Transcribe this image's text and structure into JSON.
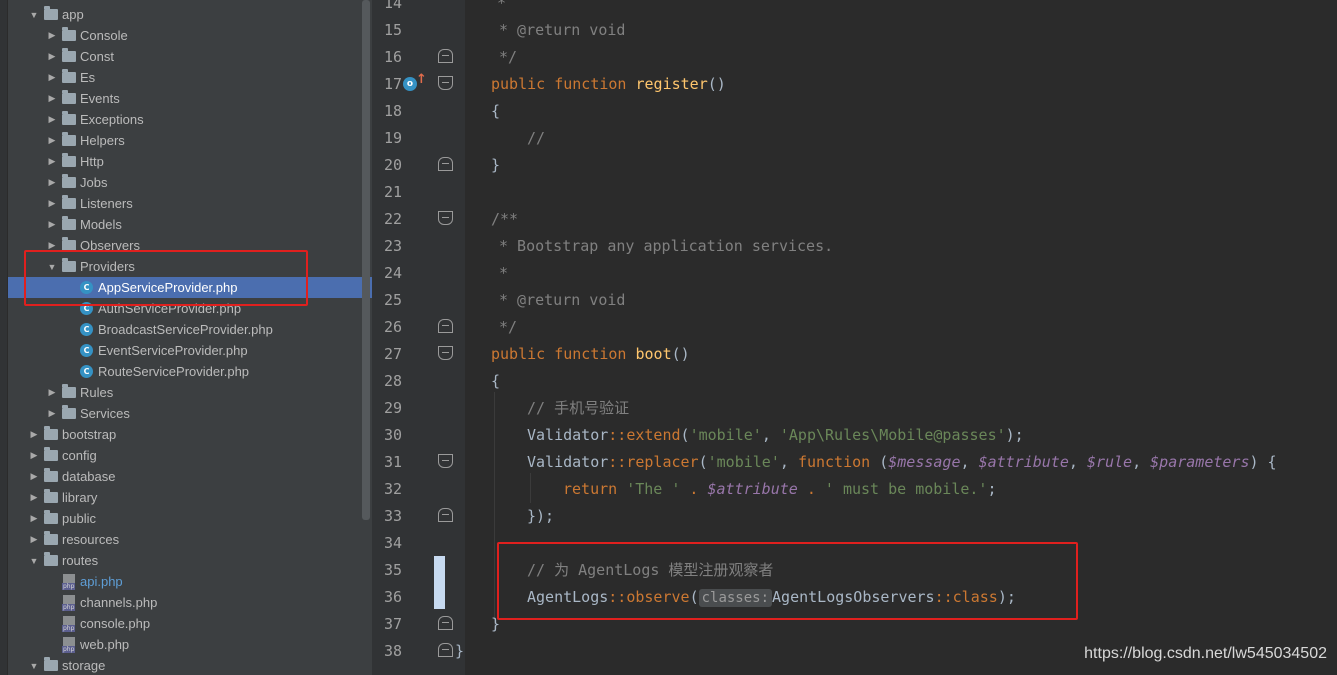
{
  "tree": {
    "rows": [
      {
        "label": "app",
        "indent": 1,
        "type": "folder",
        "state": "open"
      },
      {
        "label": "Console",
        "indent": 2,
        "type": "folder",
        "state": "closed"
      },
      {
        "label": "Const",
        "indent": 2,
        "type": "folder",
        "state": "closed"
      },
      {
        "label": "Es",
        "indent": 2,
        "type": "folder",
        "state": "closed"
      },
      {
        "label": "Events",
        "indent": 2,
        "type": "folder",
        "state": "closed"
      },
      {
        "label": "Exceptions",
        "indent": 2,
        "type": "folder",
        "state": "closed"
      },
      {
        "label": "Helpers",
        "indent": 2,
        "type": "folder",
        "state": "closed"
      },
      {
        "label": "Http",
        "indent": 2,
        "type": "folder",
        "state": "closed"
      },
      {
        "label": "Jobs",
        "indent": 2,
        "type": "folder",
        "state": "closed"
      },
      {
        "label": "Listeners",
        "indent": 2,
        "type": "folder",
        "state": "closed"
      },
      {
        "label": "Models",
        "indent": 2,
        "type": "folder",
        "state": "closed"
      },
      {
        "label": "Observers",
        "indent": 2,
        "type": "folder",
        "state": "closed"
      },
      {
        "label": "Providers",
        "indent": 2,
        "type": "folder",
        "state": "open"
      },
      {
        "label": "AppServiceProvider.php",
        "indent": 3,
        "type": "class",
        "selected": true
      },
      {
        "label": "AuthServiceProvider.php",
        "indent": 3,
        "type": "class"
      },
      {
        "label": "BroadcastServiceProvider.php",
        "indent": 3,
        "type": "class"
      },
      {
        "label": "EventServiceProvider.php",
        "indent": 3,
        "type": "class"
      },
      {
        "label": "RouteServiceProvider.php",
        "indent": 3,
        "type": "class"
      },
      {
        "label": "Rules",
        "indent": 2,
        "type": "folder",
        "state": "closed"
      },
      {
        "label": "Services",
        "indent": 2,
        "type": "folder",
        "state": "closed"
      },
      {
        "label": "bootstrap",
        "indent": 1,
        "type": "folder",
        "state": "closed"
      },
      {
        "label": "config",
        "indent": 1,
        "type": "folder",
        "state": "closed"
      },
      {
        "label": "database",
        "indent": 1,
        "type": "folder",
        "state": "closed"
      },
      {
        "label": "library",
        "indent": 1,
        "type": "folder",
        "state": "closed"
      },
      {
        "label": "public",
        "indent": 1,
        "type": "folder",
        "state": "closed"
      },
      {
        "label": "resources",
        "indent": 1,
        "type": "folder",
        "state": "closed"
      },
      {
        "label": "routes",
        "indent": 1,
        "type": "folder",
        "state": "open"
      },
      {
        "label": "api.php",
        "indent": 2,
        "type": "php",
        "link": true
      },
      {
        "label": "channels.php",
        "indent": 2,
        "type": "php"
      },
      {
        "label": "console.php",
        "indent": 2,
        "type": "php"
      },
      {
        "label": "web.php",
        "indent": 2,
        "type": "php"
      },
      {
        "label": "storage",
        "indent": 1,
        "type": "folder",
        "state": "open"
      }
    ],
    "php_badge": "php",
    "class_badge": "C"
  },
  "gutter": {
    "line_numbers": [
      "14",
      "15",
      "16",
      "17",
      "18",
      "19",
      "20",
      "21",
      "22",
      "23",
      "24",
      "25",
      "26",
      "27",
      "28",
      "29",
      "30",
      "31",
      "32",
      "33",
      "34",
      "35",
      "36",
      "37",
      "38"
    ],
    "override_badge": "o",
    "override_arrow": "↑"
  },
  "code": {
    "l14": "*",
    "l15": "* @return void",
    "l16": "*/",
    "l17_kw1": "public",
    "l17_kw2": "function",
    "l17_fn": "register",
    "l17_rest": "()",
    "l18": "{",
    "l19": "//",
    "l20": "}",
    "l22": "/**",
    "l23": "* Bootstrap any application services.",
    "l24": "*",
    "l25": "* @return void",
    "l26": "*/",
    "l27_kw1": "public",
    "l27_kw2": "function",
    "l27_fn": "boot",
    "l27_rest": "()",
    "l28": "{",
    "l29": "// 手机号验证",
    "l30_cls": "Validator",
    "l30_op": "::",
    "l30_m": "extend",
    "l30_p1": "(",
    "l30_s1": "'mobile'",
    "l30_c": ", ",
    "l30_s2": "'App\\Rules\\Mobile@passes'",
    "l30_end": ");",
    "l31_cls": "Validator",
    "l31_op": "::",
    "l31_m": "replacer",
    "l31_p1": "(",
    "l31_s1": "'mobile'",
    "l31_c1": ", ",
    "l31_kw": "function",
    "l31_p2": " (",
    "l31_v1": "$message",
    "l31_c2": ", ",
    "l31_v2": "$attribute",
    "l31_c3": ", ",
    "l31_v3": "$rule",
    "l31_c4": ", ",
    "l31_v4": "$parameters",
    "l31_end": ") {",
    "l32_kw": "return",
    "l32_s1": "'The '",
    "l32_dot1": " . ",
    "l32_v": "$attribute",
    "l32_dot2": " . ",
    "l32_s2": "' must be mobile.'",
    "l32_end": ";",
    "l33": "});",
    "l35": "// 为 AgentLogs 模型注册观察者",
    "l36_cls": "AgentLogs",
    "l36_op": "::",
    "l36_m": "observe",
    "l36_p": "(",
    "l36_hint": "classes:",
    "l36_arg": "AgentLogsObservers",
    "l36_op2": "::",
    "l36_kw": "class",
    "l36_end": ");",
    "l37": "}",
    "l38": "}"
  },
  "watermark": "https://blog.csdn.net/lw545034502",
  "colors": {
    "highlight_box": "#e0201e",
    "selection": "#4b6eaf",
    "keyword": "#cc7832",
    "function": "#ffc66d",
    "string": "#6a8759",
    "comment": "#808080",
    "variable": "#9876aa"
  }
}
